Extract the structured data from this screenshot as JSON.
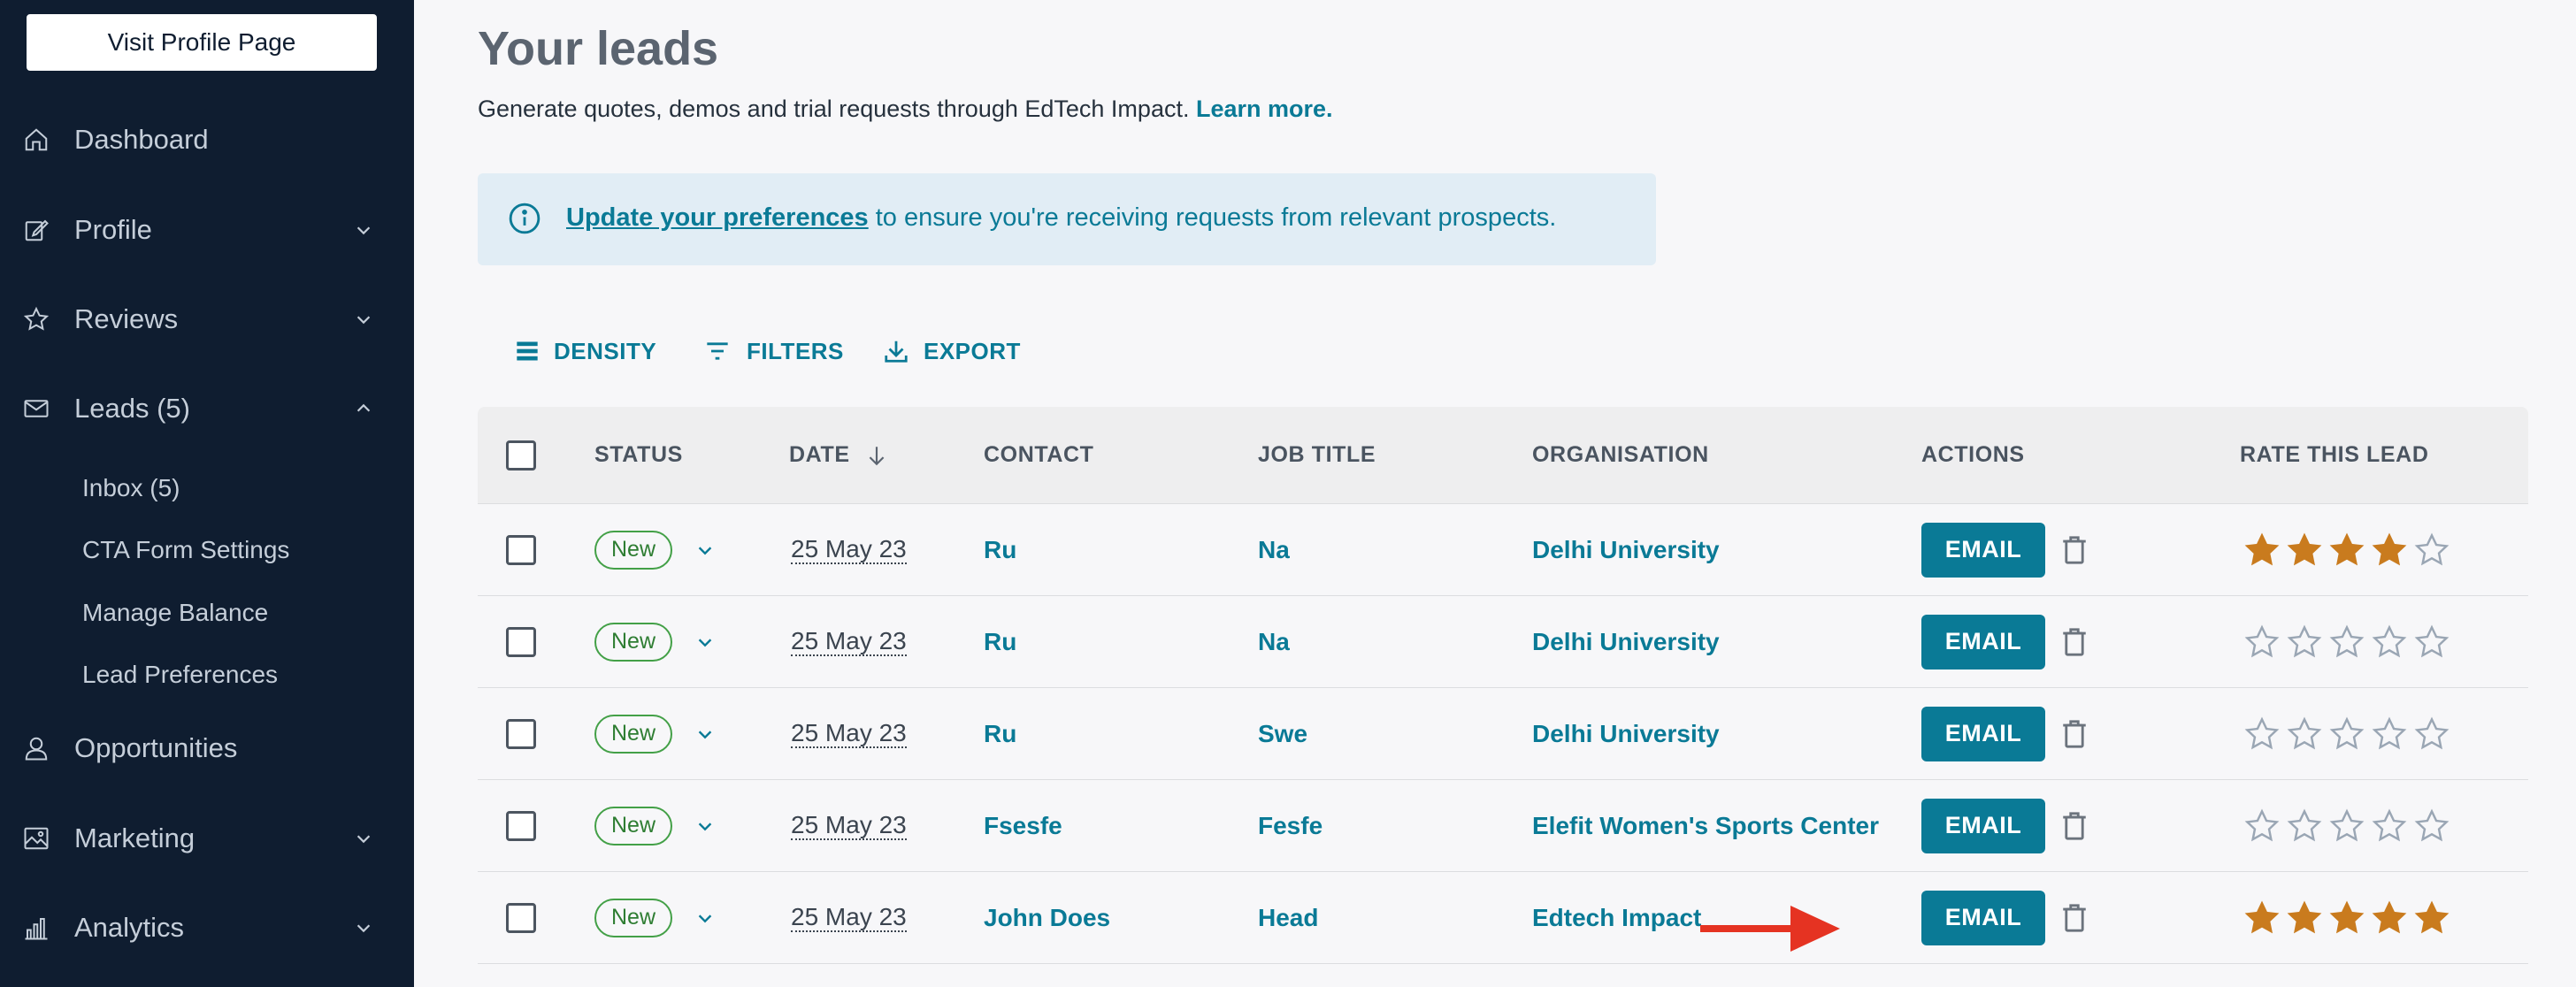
{
  "sidebar": {
    "profile_button": "Visit Profile Page",
    "items": [
      {
        "label": "Dashboard",
        "icon": "home-icon"
      },
      {
        "label": "Profile",
        "icon": "edit-icon"
      },
      {
        "label": "Reviews",
        "icon": "star-icon"
      },
      {
        "label": "Leads (5)",
        "icon": "mail-icon"
      },
      {
        "label": "Opportunities",
        "icon": "user-icon"
      },
      {
        "label": "Marketing",
        "icon": "image-icon"
      },
      {
        "label": "Analytics",
        "icon": "bar-chart-icon"
      }
    ],
    "sub_items": [
      {
        "label": "Inbox (5)"
      },
      {
        "label": "CTA Form Settings"
      },
      {
        "label": "Manage Balance"
      },
      {
        "label": "Lead Preferences"
      }
    ]
  },
  "header": {
    "title": "Your leads",
    "subtitle": "Generate quotes, demos and trial requests through EdTech Impact.",
    "learn_more": "Learn more."
  },
  "info": {
    "link": "Update your preferences",
    "text": " to ensure you're receiving requests from relevant prospects."
  },
  "toolbar": {
    "density": "DENSITY",
    "filters": "FILTERS",
    "export": "EXPORT"
  },
  "table": {
    "columns": {
      "status": "STATUS",
      "date": "DATE",
      "contact": "CONTACT",
      "job_title": "JOB TITLE",
      "organisation": "ORGANISATION",
      "actions": "ACTIONS",
      "rate": "RATE THIS LEAD"
    },
    "email_label": "EMAIL",
    "rows": [
      {
        "status": "New",
        "date": "25 May 23",
        "contact": "Ru",
        "job_title": "Na",
        "organisation": "Delhi University",
        "rating": 4
      },
      {
        "status": "New",
        "date": "25 May 23",
        "contact": "Ru",
        "job_title": "Na",
        "organisation": "Delhi University",
        "rating": 0
      },
      {
        "status": "New",
        "date": "25 May 23",
        "contact": "Ru",
        "job_title": "Swe",
        "organisation": "Delhi University",
        "rating": 0
      },
      {
        "status": "New",
        "date": "25 May 23",
        "contact": "Fsesfe",
        "job_title": "Fesfe",
        "organisation": "Elefit Women's Sports Center",
        "rating": 0
      },
      {
        "status": "New",
        "date": "25 May 23",
        "contact": "John Does",
        "job_title": "Head",
        "organisation": "Edtech Impact",
        "rating": 5
      }
    ]
  },
  "colors": {
    "sidebar_bg": "#0f1d30",
    "accent": "#0a7a96",
    "star_filled": "#c97b1e",
    "star_empty": "#9aa6b4",
    "status_green": "#43a047",
    "arrow_red": "#e53322"
  }
}
